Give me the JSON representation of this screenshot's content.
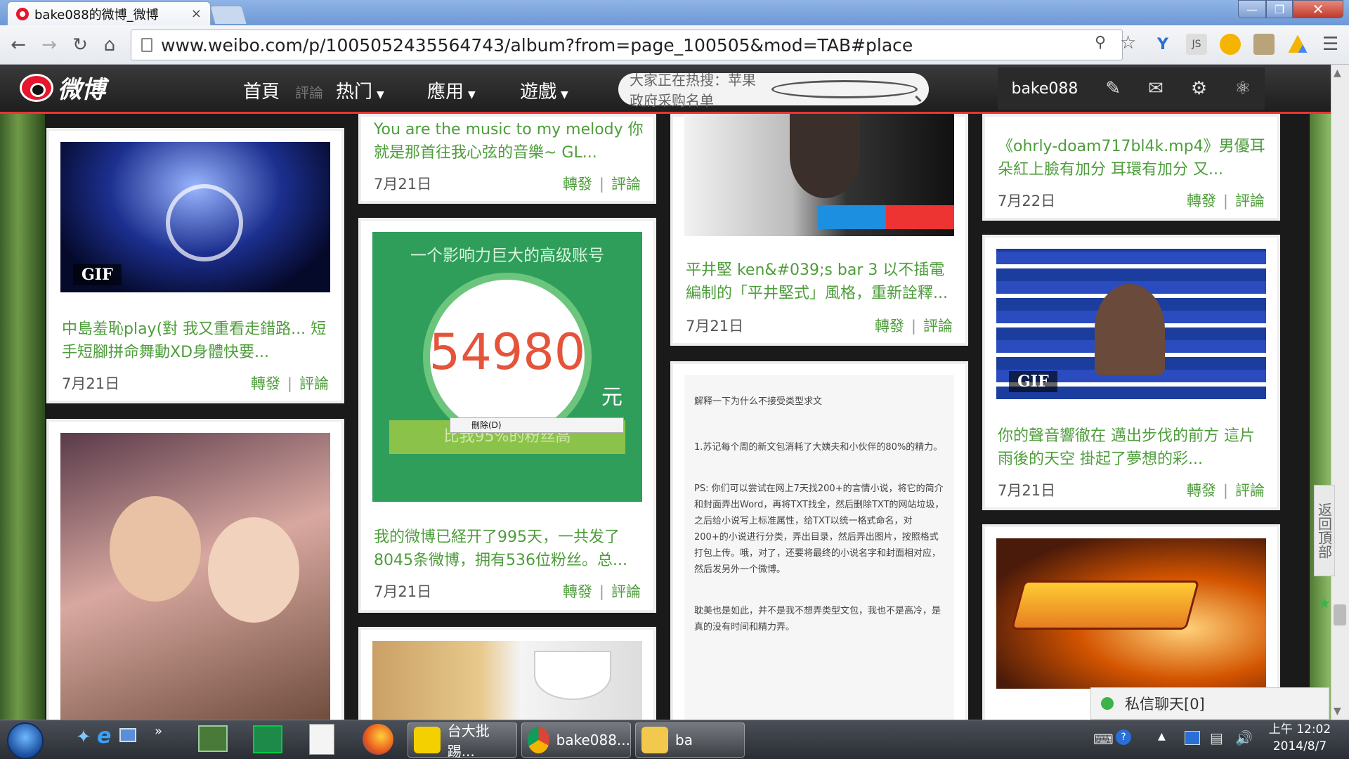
{
  "browser": {
    "tab_title": "bake088的微博_微博",
    "url": "www.weibo.com/p/1005052435564743/album?from=page_100505&mod=TAB#place",
    "close_glyph": "×"
  },
  "header": {
    "logo_text": "微博",
    "nav": [
      {
        "label": "首頁"
      },
      {
        "label": "評論"
      },
      {
        "label": "热门"
      },
      {
        "label": "應用"
      },
      {
        "label": "遊戲"
      }
    ],
    "search_placeholder": "大家正在热搜：苹果 政府采购名单",
    "username": "bake088"
  },
  "cards": {
    "c1": {
      "text": "中島羞恥play(對 我又重看走錯路... 短手短腳拼命舞動XD身體快要...",
      "date": "7月21日",
      "gif": "GIF"
    },
    "c3": {
      "text": "You are the music to my melody 你就是那首往我心弦的音樂~ GL...",
      "date": "7月21日"
    },
    "c4": {
      "text": "我的微博已経开了995天，一共发了8045条微博，拥有536位粉丝。总...",
      "date": "7月21日",
      "img_title": "一个影响力巨大的高级账号",
      "img_number": "54980",
      "img_unit": "元",
      "img_ribbon": "比我95%的粉丝高"
    },
    "c6": {
      "text": "平井堅 ken&#039;s bar 3 以不插電編制的「平井堅式」風格，重新詮釋...",
      "date": "7月21日"
    },
    "c7": {
      "lines": [
        "解释一下为什么不接受类型求文",
        "1.苏记每个周的新文包消耗了大姨夫和小伙伴的80%的精力。",
        "PS: 你们可以尝试在网上7天找200+的言情小说，将它的简介和封面弄出Word，再将TXT找全，然后删除TXT的网站垃圾，之后给小说写上标准属性，给TXT以统一格式命名，对200+的小说进行分类，弄出目录，然后弄出图片，按照格式打包上传。哦，对了，还要将最终的小说名字和封面相对应，然后发另外一个微博。",
        "耽美也是如此，并不是我不想弄类型文包，我也不是高冷，是真的没有时间和精力弄。"
      ]
    },
    "c8": {
      "text": "《ohrly-doam717bl4k.mp4》男優耳朵紅上臉有加分 耳環有加分 又...",
      "date": "7月22日"
    },
    "c9": {
      "text": "你的聲音響徹在 邁出步伐的前方 這片雨後的天空 掛起了夢想的彩...",
      "date": "7月21日",
      "gif": "GIF"
    }
  },
  "actions": {
    "repost": "轉發",
    "comment": "評論",
    "sep": "|"
  },
  "context_menu": {
    "item": "刪除(D)"
  },
  "chat": {
    "label": "私信聊天[0]"
  },
  "backtop": {
    "label": "返回頂部"
  },
  "taskbar": {
    "apps": [
      {
        "label": "台大批踢..."
      },
      {
        "label": "bake088..."
      },
      {
        "label": "ba"
      }
    ],
    "clock_time": "上午 12:02",
    "clock_date": "2014/8/7"
  },
  "colors": {
    "accent_green": "#4e9d3b",
    "weibo_red": "#e6162d"
  }
}
